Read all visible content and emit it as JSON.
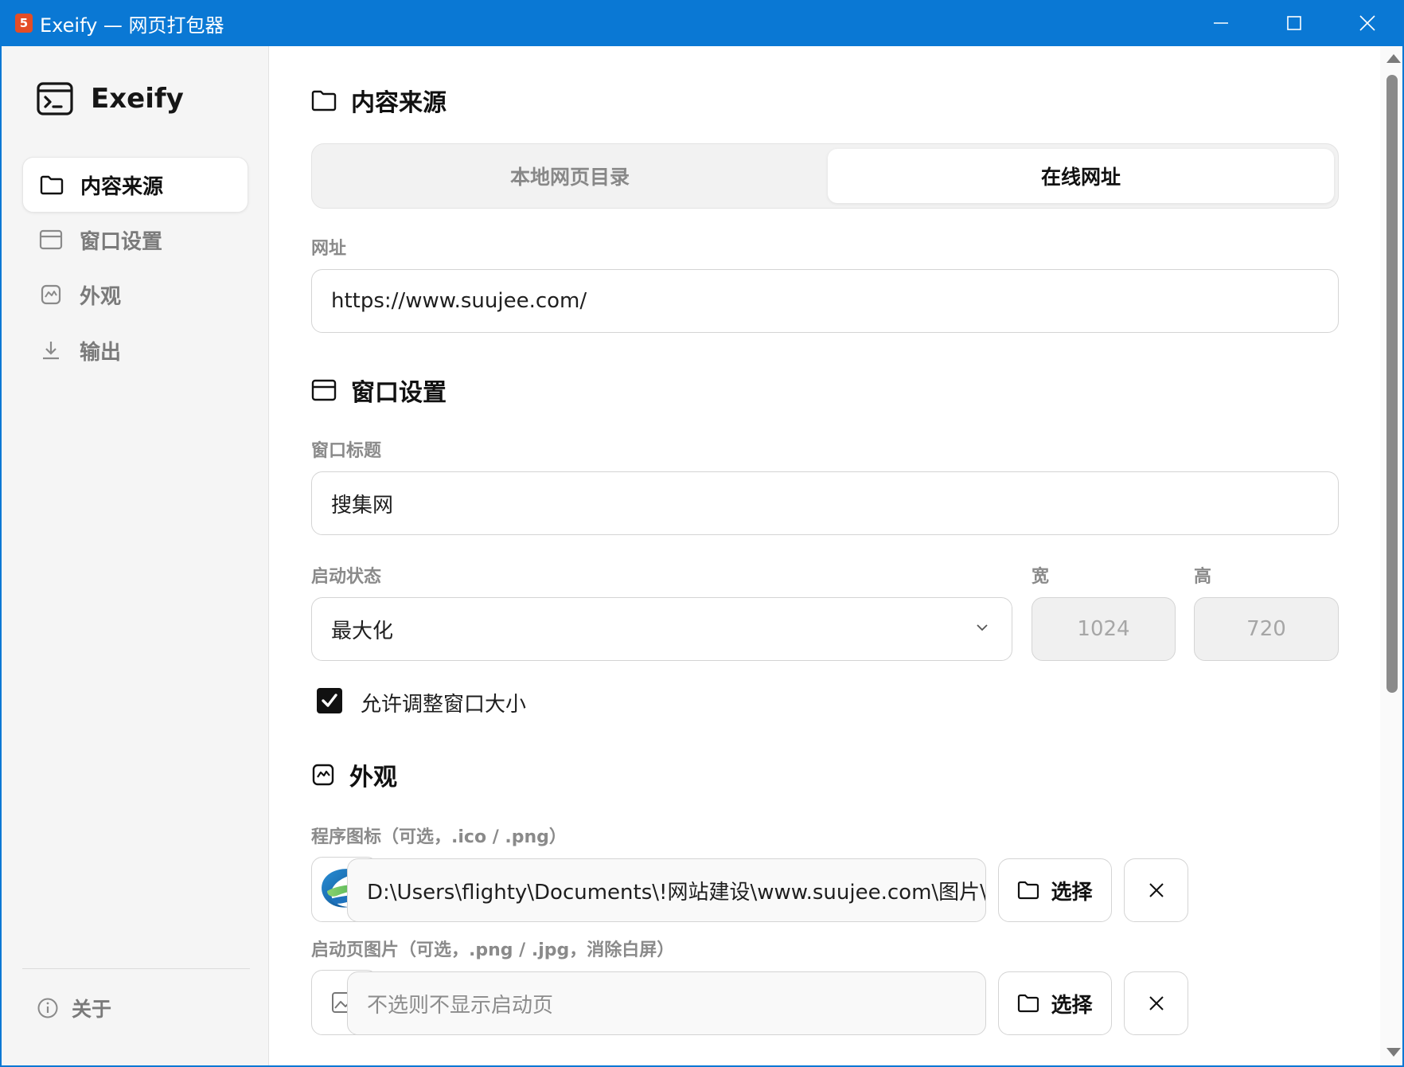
{
  "window": {
    "app_icon_glyph": "5",
    "title": "Exeify — 网页打包器",
    "minimize_icon": "minimize-icon",
    "maximize_icon": "maximize-icon",
    "close_icon": "close-icon",
    "accent_color": "#0a78d4"
  },
  "sidebar": {
    "brand": "Exeify",
    "items": [
      {
        "label": "内容来源",
        "icon": "folder-icon",
        "active": true
      },
      {
        "label": "窗口设置",
        "icon": "window-icon",
        "active": false
      },
      {
        "label": "外观",
        "icon": "image-icon",
        "active": false
      },
      {
        "label": "输出",
        "icon": "download-icon",
        "active": false
      }
    ],
    "about": "关于"
  },
  "content_source": {
    "title": "内容来源",
    "options": [
      "本地网页目录",
      "在线网址"
    ],
    "selected": "在线网址",
    "url_label": "网址",
    "url_value": "https://www.suujee.com/"
  },
  "window_settings": {
    "title": "窗口设置",
    "window_title_label": "窗口标题",
    "window_title_value": "搜集网",
    "startup_label": "启动状态",
    "startup_value": "最大化",
    "width_label": "宽",
    "width_value": "1024",
    "height_label": "高",
    "height_value": "720",
    "resizable_label": "允许调整窗口大小",
    "resizable_checked": true
  },
  "appearance": {
    "title": "外观",
    "icon_label": "程序图标（可选，.ico / .png）",
    "icon_path": "D:\\Users\\flighty\\Documents\\!网站建设\\www.suujee.com\\图片\\logo.pı",
    "choose_label": "选择",
    "splash_label": "启动页图片（可选，.png / .jpg，消除白屏）",
    "splash_placeholder": "不选则不显示启动页",
    "choose_label_2": "选择"
  }
}
